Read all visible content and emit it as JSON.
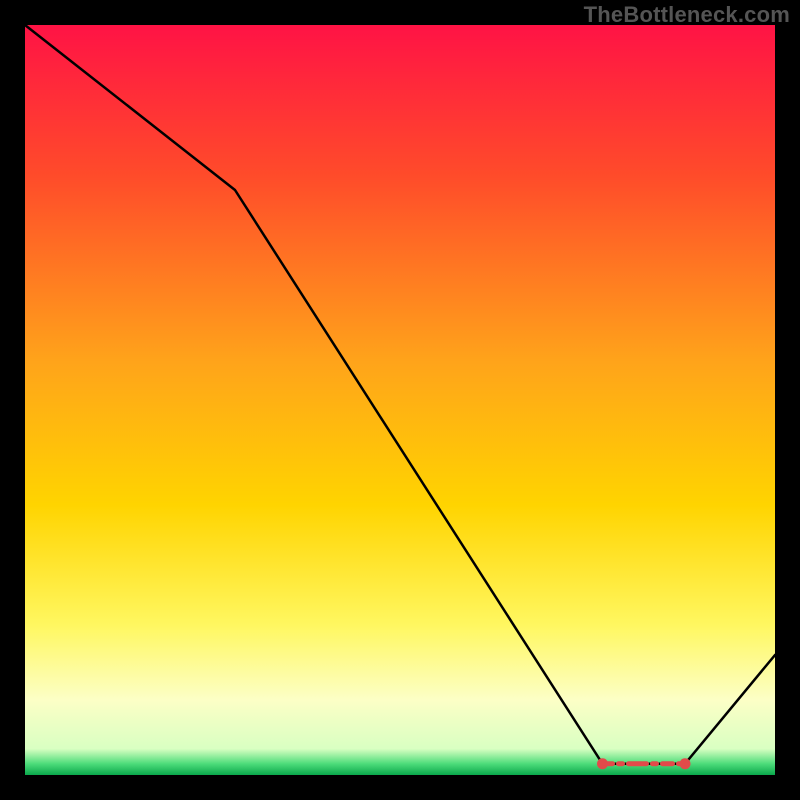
{
  "watermark": "TheBottleneck.com",
  "chart_data": {
    "type": "line",
    "title": "",
    "xlabel": "",
    "ylabel": "",
    "xlim": [
      0,
      100
    ],
    "ylim": [
      0,
      100
    ],
    "grid": false,
    "legend": false,
    "x": [
      0,
      28,
      77,
      82,
      88,
      100
    ],
    "y": [
      100,
      78,
      1.5,
      1.5,
      1.5,
      16
    ],
    "optimal_band": {
      "x_start": 77,
      "x_end": 88,
      "y": 1.5
    },
    "gradient_stops": [
      {
        "offset": 0.0,
        "color": "#ff1345"
      },
      {
        "offset": 0.2,
        "color": "#ff4b2a"
      },
      {
        "offset": 0.45,
        "color": "#ffa41a"
      },
      {
        "offset": 0.64,
        "color": "#ffd400"
      },
      {
        "offset": 0.8,
        "color": "#fff760"
      },
      {
        "offset": 0.9,
        "color": "#fcffc6"
      },
      {
        "offset": 0.965,
        "color": "#d9ffc2"
      },
      {
        "offset": 0.985,
        "color": "#4ddc7a"
      },
      {
        "offset": 1.0,
        "color": "#0aa84c"
      }
    ],
    "marker_color": "#e24a4a",
    "line_color": "#000000"
  }
}
